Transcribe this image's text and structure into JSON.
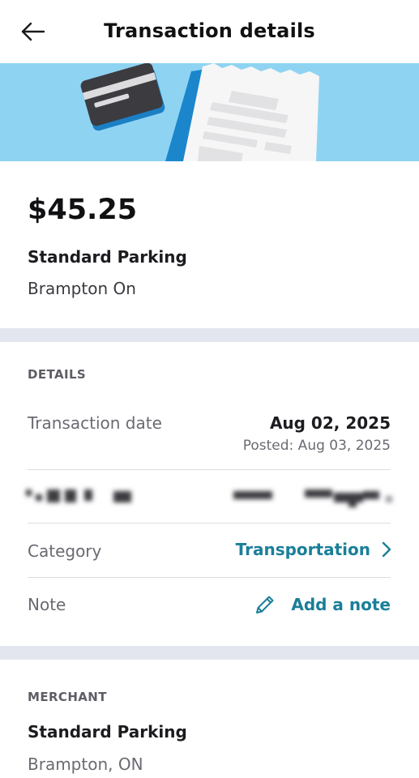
{
  "header": {
    "title": "Transaction details",
    "back_icon": "arrow-left-icon"
  },
  "banner": {
    "illustration": "card-and-receipt-illustration",
    "background_color": "#8fd3f2"
  },
  "summary": {
    "amount": "$45.25",
    "merchant_name": "Standard Parking",
    "merchant_location": "Brampton On"
  },
  "details": {
    "heading": "DETAILS",
    "transaction_date_label": "Transaction date",
    "transaction_date_value": "Aug 02, 2025",
    "posted_value": "Posted: Aug 03, 2025",
    "blurred_row_note": "redacted",
    "category_label": "Category",
    "category_value": "Transportation",
    "category_icon": "chevron-right-icon",
    "note_label": "Note",
    "note_action": "Add a note",
    "note_icon": "pencil-icon"
  },
  "merchant": {
    "heading": "MERCHANT",
    "name": "Standard Parking",
    "address": "Brampton, ON"
  },
  "colors": {
    "accent": "#1a7f99",
    "divider": "#e3e6ee",
    "banner": "#8fd3f2"
  }
}
